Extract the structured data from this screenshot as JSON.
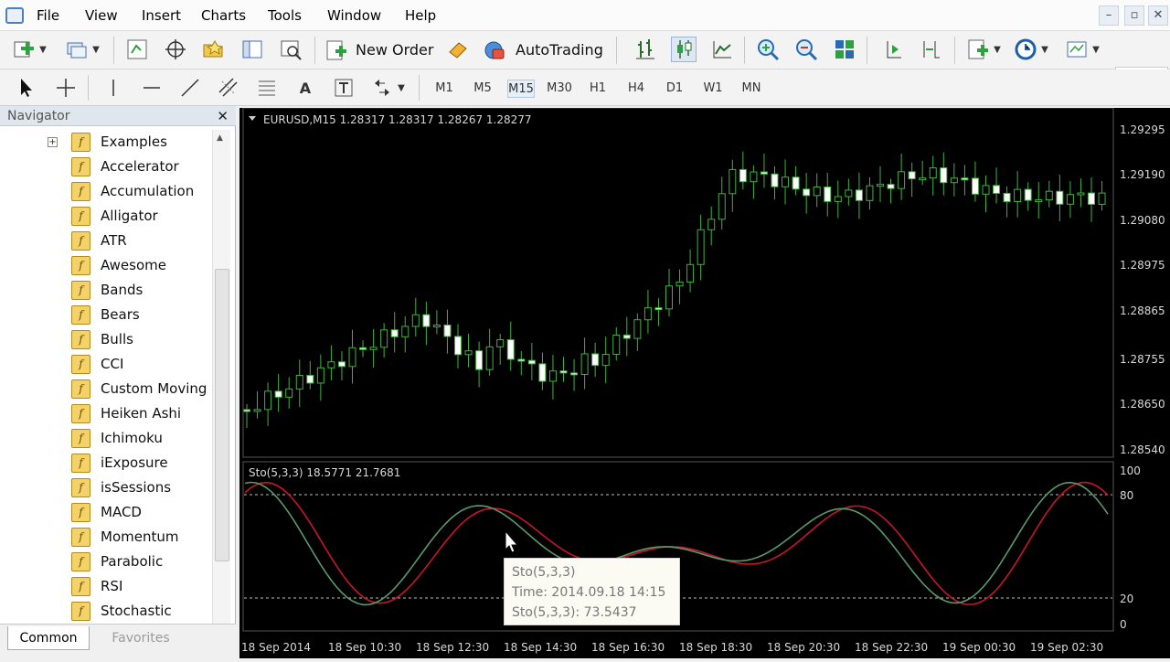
{
  "menu": {
    "items": [
      "File",
      "View",
      "Insert",
      "Charts",
      "Tools",
      "Window",
      "Help"
    ]
  },
  "window_controls": {
    "minimize": "–",
    "restore": "▫",
    "close": "✕"
  },
  "toolbar": {
    "new_order_label": "New Order",
    "autotrading_label": "AutoTrading"
  },
  "timeframes": [
    "M1",
    "M5",
    "M15",
    "M30",
    "H1",
    "H4",
    "D1",
    "W1",
    "MN"
  ],
  "active_timeframe": "M15",
  "navigator": {
    "title": "Navigator",
    "close_glyph": "✕",
    "items": [
      "Examples",
      "Accelerator",
      "Accumulation",
      "Alligator",
      "ATR",
      "Awesome",
      "Bands",
      "Bears",
      "Bulls",
      "CCI",
      "Custom Moving",
      "Heiken Ashi",
      "Ichimoku",
      "iExposure",
      "isSessions",
      "MACD",
      "Momentum",
      "Parabolic",
      "RSI",
      "Stochastic"
    ],
    "tabs": {
      "common": "Common",
      "favorites": "Favorites"
    }
  },
  "chart": {
    "header": "EURUSD,M15  1.28317 1.28317 1.28267 1.28277",
    "price_axis": [
      "1.29295",
      "1.29190",
      "1.29080",
      "1.28975",
      "1.28865",
      "1.28755",
      "1.28650",
      "1.28540"
    ],
    "indicator_header": "Sto(5,3,3) 18.5771 21.7681",
    "indicator_axis": [
      "100",
      "80",
      "20",
      "0"
    ],
    "time_axis": [
      "18 Sep 2014",
      "18 Sep 10:30",
      "18 Sep 12:30",
      "18 Sep 14:30",
      "18 Sep 16:30",
      "18 Sep 18:30",
      "18 Sep 20:30",
      "18 Sep 22:30",
      "19 Sep 00:30",
      "19 Sep 02:30"
    ],
    "colors": {
      "background": "#000000",
      "candle": "#3fb33f",
      "bull_body": "#000000",
      "bear_body": "#ffffff",
      "main_line": "#5a9a6a",
      "signal_line": "#c8152a",
      "levels": "#bdbdbd"
    }
  },
  "tooltip": {
    "line1": "Sto(5,3,3)",
    "line2": "Time: 2014.09.18 14:15",
    "line3": "Sto(5,3,3): 73.5437"
  }
}
